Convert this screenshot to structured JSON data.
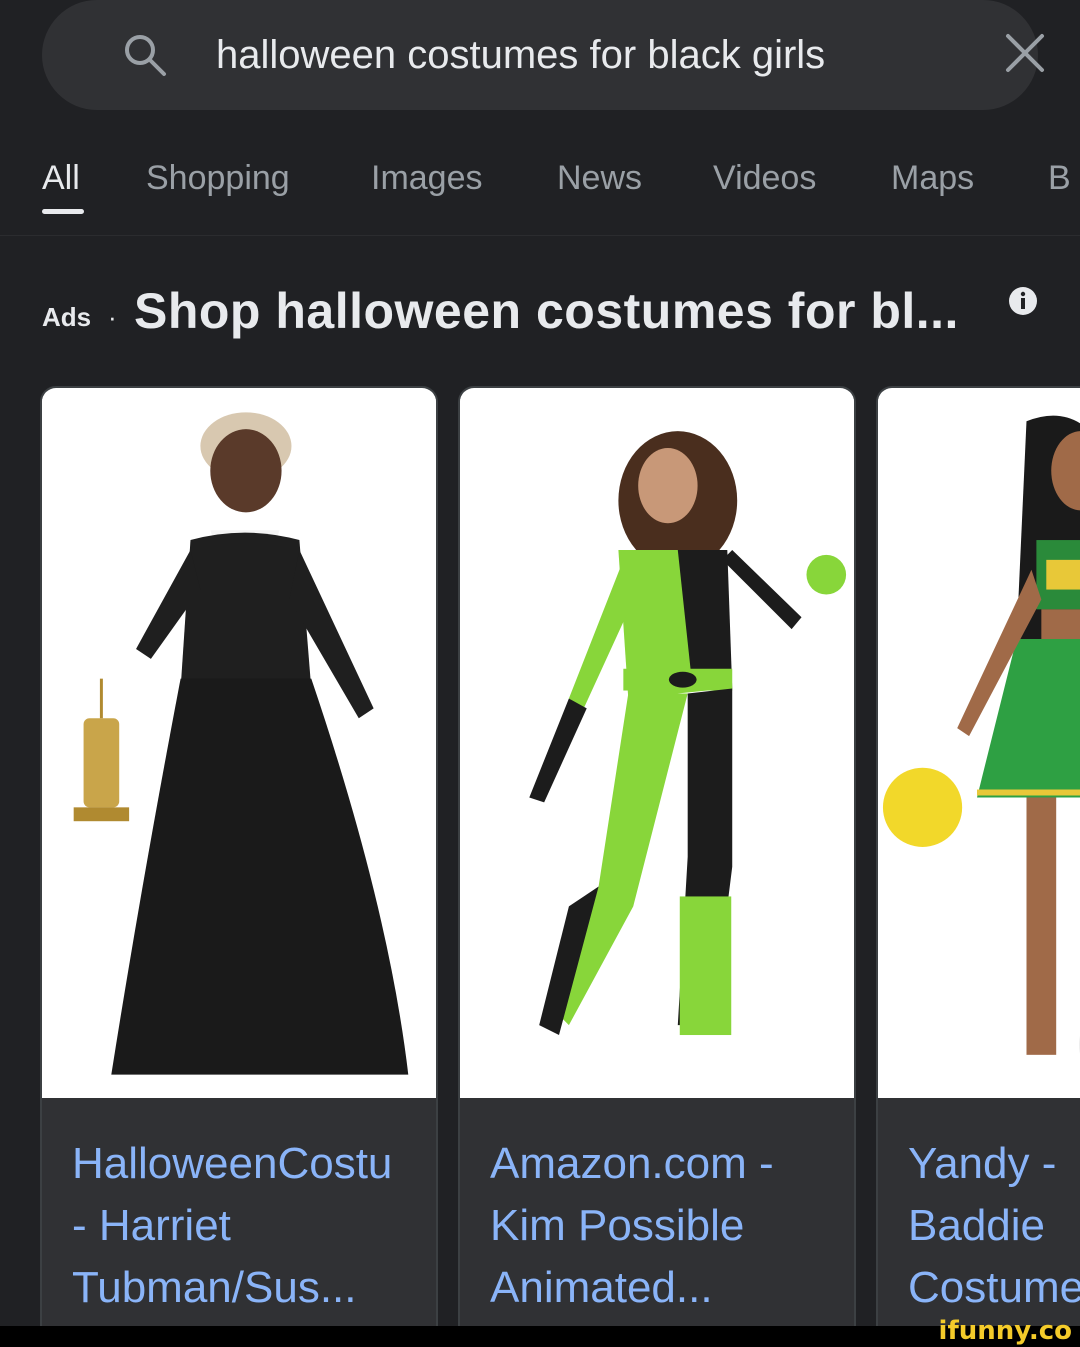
{
  "search": {
    "query": "halloween costumes for black girls",
    "icon": "search-icon",
    "clear_icon": "close-icon"
  },
  "tabs": [
    {
      "label": "All",
      "active": true
    },
    {
      "label": "Shopping",
      "active": false
    },
    {
      "label": "Images",
      "active": false
    },
    {
      "label": "News",
      "active": false
    },
    {
      "label": "Videos",
      "active": false
    },
    {
      "label": "Maps",
      "active": false
    },
    {
      "label": "B",
      "active": false
    }
  ],
  "ads": {
    "label": "Ads",
    "separator": "·",
    "title": "Shop halloween costumes for bl...",
    "info_icon": "info-icon"
  },
  "cards": [
    {
      "title": "HalloweenCostu\n- Harriet\nTubman/Sus...",
      "image": "black-dress-costume-image"
    },
    {
      "title": "Amazon.com -\nKim Possible\nAnimated...",
      "image": "green-black-bodysuit-costume-image"
    },
    {
      "title": "Yandy -\nBaddie\nCostume",
      "image": "cheerleader-costume-image"
    }
  ],
  "watermark": "ifunny.co",
  "colors": {
    "background": "#202124",
    "surface": "#303134",
    "link": "#8ab4f8",
    "text": "#e8eaed",
    "muted": "#9aa0a6",
    "watermark": "#f4cb2a"
  }
}
